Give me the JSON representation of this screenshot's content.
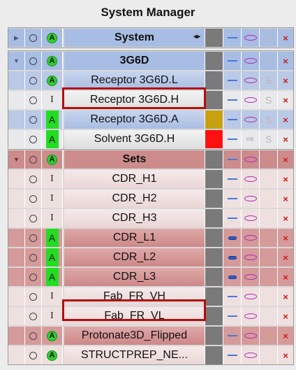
{
  "window": {
    "title": "System Manager"
  },
  "system_row": {
    "name": "System"
  },
  "molecule_group": {
    "header": {
      "name": "3G6D"
    },
    "rows": [
      {
        "name": "Receptor 3G6D.L",
        "style": "blue",
        "active": "A-badge",
        "color": "#7a7a7a",
        "ellipse": true,
        "s": true
      },
      {
        "name": "Receptor 3G6D.H",
        "style": "white",
        "active": "I",
        "color": "#7a7a7a",
        "ellipse": true,
        "s": true
      },
      {
        "name": "Receptor 3G6D.A",
        "style": "blue",
        "active": "A-box",
        "color": "#c8a010",
        "ellipse": true,
        "s": true
      },
      {
        "name": "Solvent 3G6D.H",
        "style": "white",
        "active": "A-box",
        "color": "#ff1010",
        "arrow": true,
        "s": true
      }
    ]
  },
  "sets_group": {
    "header": {
      "name": "Sets"
    },
    "rows": [
      {
        "name": "CDR_H1",
        "style": "pink",
        "active": "I",
        "dash": "thin"
      },
      {
        "name": "CDR_H2",
        "style": "pink",
        "active": "I",
        "dash": "thin"
      },
      {
        "name": "CDR_H3",
        "style": "pink",
        "active": "I",
        "dash": "thin"
      },
      {
        "name": "CDR_L1",
        "style": "red",
        "active": "A-box",
        "dash": "bold"
      },
      {
        "name": "CDR_L2",
        "style": "red",
        "active": "A-box",
        "dash": "bold"
      },
      {
        "name": "CDR_L3",
        "style": "red",
        "active": "A-box",
        "dash": "bold"
      },
      {
        "name": "Fab_FR_VH",
        "style": "pink",
        "active": "I",
        "dash": "thin"
      },
      {
        "name": "Fab_FR_VL",
        "style": "pink",
        "active": "I",
        "dash": "thin"
      },
      {
        "name": "Protonate3D_Flipped",
        "style": "red",
        "active": "A-badge",
        "dash": "thin"
      },
      {
        "name": "STRUCTPREP_NE...",
        "style": "pink",
        "active": "A-badge",
        "dash": "thin"
      }
    ]
  },
  "labels": {
    "active": "A",
    "inactive": "I",
    "s": "S",
    "close": "×",
    "arrows": "◂▸"
  },
  "colors": {
    "highlight": "#b01010",
    "group_gray": "#7a7a7a"
  }
}
